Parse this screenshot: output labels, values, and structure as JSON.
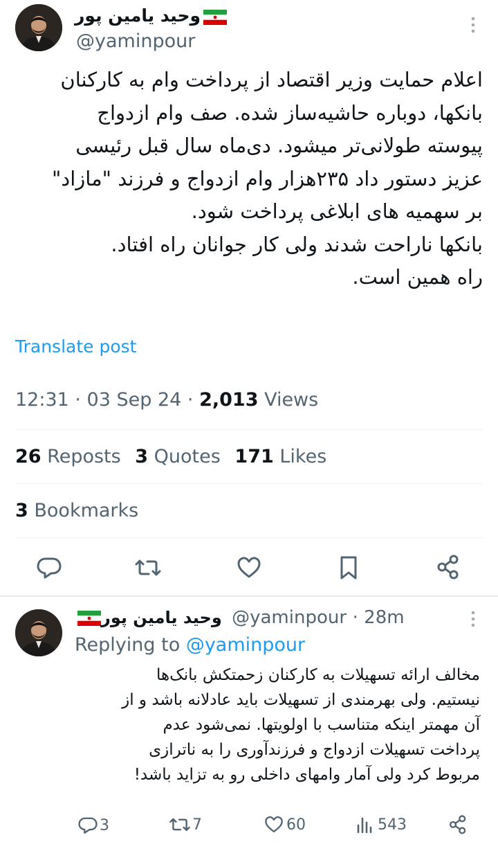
{
  "tweet": {
    "author_name": "وحید یامین پور",
    "author_handle": "@yaminpour",
    "text": "اعلام حمایت وزیر اقتصاد از پرداخت وام به کارکنان\nبانکها، دوباره حاشیه‌ساز شده. صف وام ازدواج\nپیوسته طولانی‌تر میشود. دی‌ماه سال قبل رئیسی\nعزیز دستور داد ۲۳۵هزار وام ازدواج و فرزند \"مازاد\"\nبر سهمیه های ابلاغی پرداخت شود.\nبانکها ناراحت شدند ولی کار جوانان راه افتاد.\nراه همین است.",
    "translate_label": "Translate post",
    "time": "12:31 · 03 Sep 24 · ",
    "views_count": "2,013",
    "views_label": " Views",
    "reposts_count": "26",
    "reposts_label": " Reposts",
    "quotes_count": "3",
    "quotes_label": " Quotes",
    "likes_count": "171",
    "likes_label": " Likes",
    "bookmarks_count": "3",
    "bookmarks_label": " Bookmarks",
    "more_glyph": "⋮"
  },
  "reply": {
    "author_name": "وحید یامین پور",
    "author_handle": "@yaminpour",
    "time": "· 28m",
    "replying_prefix": "Replying to ",
    "replying_handle": "@yaminpour",
    "text": "مخالف ارائه تسهیلات به کارکنان زحمتکش بانک‌ها\nنیستیم. ولی بهرمندی از تسهیلات باید عادلانه باشد و از\nآن مهمتر اینکه متناسب با اولویتها. نمی‌شود عدم\nپرداخت تسهیلات ازدواج و فرزندآوری را به ناترازی\nمربوط کرد ولی آمار وامهای داخلی رو به تزاید باشد!",
    "reply_count": "3",
    "repost_count": "7",
    "like_count": "60",
    "view_count": "543"
  },
  "icons": [
    "reply-icon",
    "repost-icon",
    "like-icon",
    "bookmark-icon",
    "share-icon",
    "views-icon",
    "iran-flag-icon",
    "more-icon"
  ],
  "colors": {
    "link": "#1d9bf0",
    "secondary": "#536471",
    "text": "#0f1419"
  }
}
